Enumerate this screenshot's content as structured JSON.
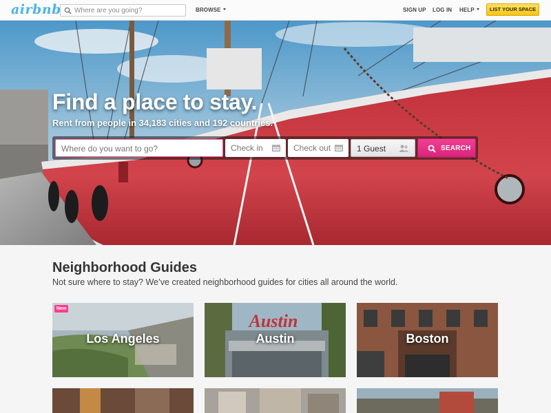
{
  "header": {
    "logo": "airbnb",
    "search_placeholder": "Where are you going?",
    "browse": "BROWSE",
    "sign_up": "SIGN UP",
    "log_in": "LOG IN",
    "help": "HELP",
    "list_space": "LIST YOUR SPACE"
  },
  "hero": {
    "title": "Find a place to stay.",
    "subtitle": "Rent from people in 34,183 cities and 192 countries.",
    "where_placeholder": "Where do you want to go?",
    "check_in_placeholder": "Check in",
    "check_out_placeholder": "Check out",
    "guests": "1 Guest",
    "search_label": "SEARCH"
  },
  "guides": {
    "title": "Neighborhood Guides",
    "description": "Not sure where to stay? We’ve created neighborhood guides for cities all around the world.",
    "cities": [
      {
        "name": "Los Angeles",
        "badge": "New"
      },
      {
        "name": "Austin"
      },
      {
        "name": "Boston"
      }
    ]
  },
  "colors": {
    "accent_pink": "#ff3d8b",
    "logo_blue": "#4cb3e6",
    "list_space_yellow": "#f5c518"
  }
}
